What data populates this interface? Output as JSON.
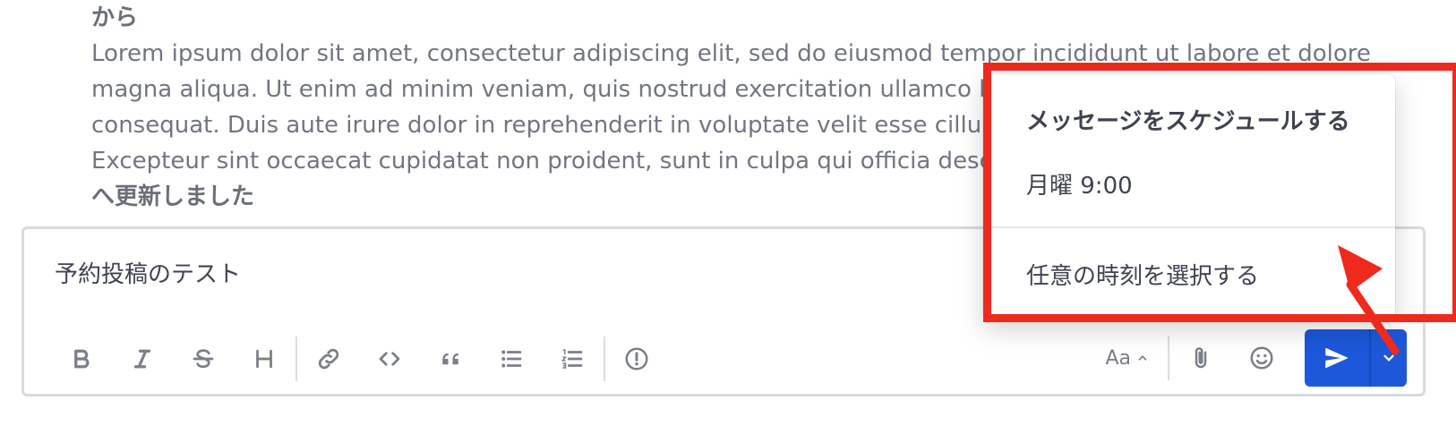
{
  "message": {
    "from_label": "から",
    "lines": [
      "Lorem ipsum dolor sit amet, consectetur adipiscing elit, sed do eiusmod tempor incididunt ut labore et dolore",
      "magna aliqua. Ut enim ad minim veniam, quis nostrud exercitation ullamco l",
      "consequat. Duis aute irure dolor in reprehenderit in voluptate velit esse cillur",
      "Excepteur sint occaecat cupidatat non proident, sunt in culpa qui officia dese"
    ],
    "to_label": "へ更新しました"
  },
  "composer": {
    "text": "予約投稿のテスト",
    "format_label": "Aa"
  },
  "schedule_menu": {
    "title": "メッセージをスケジュールする",
    "option_monday": "月曜 9:00",
    "option_custom": "任意の時刻を選択する"
  },
  "colors": {
    "accent": "#1c58d9",
    "highlight": "#ef2a1d"
  },
  "icons": {
    "toolbar": [
      "bold-icon",
      "italic-icon",
      "strikethrough-icon",
      "heading-icon",
      "link-icon",
      "code-icon",
      "quote-icon",
      "bulleted-list-icon",
      "numbered-list-icon",
      "priority-icon"
    ],
    "right": [
      "attachment-icon",
      "emoji-icon",
      "send-icon",
      "chevron-down-icon"
    ]
  }
}
